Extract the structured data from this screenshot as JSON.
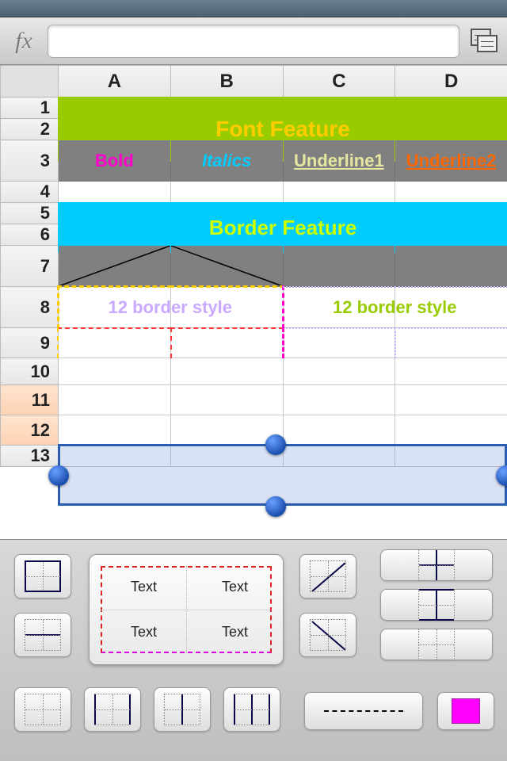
{
  "formula": {
    "label": "fx",
    "value": ""
  },
  "columns": [
    "A",
    "B",
    "C",
    "D"
  ],
  "rows": [
    "1",
    "2",
    "3",
    "4",
    "5",
    "6",
    "7",
    "8",
    "9",
    "10",
    "11",
    "12",
    "13"
  ],
  "cells": {
    "font_feature": "Font Feature",
    "border_feature": "Border Feature",
    "bold": "Bold",
    "italics": "Italics",
    "under1": "Underline1",
    "under2": "Underline2",
    "bs_left": "12 border style",
    "bs_right": "12 border style"
  },
  "preview": {
    "t1": "Text",
    "t2": "Text",
    "t3": "Text",
    "t4": "Text"
  },
  "colors": {
    "swatch": "#ff00ff"
  }
}
